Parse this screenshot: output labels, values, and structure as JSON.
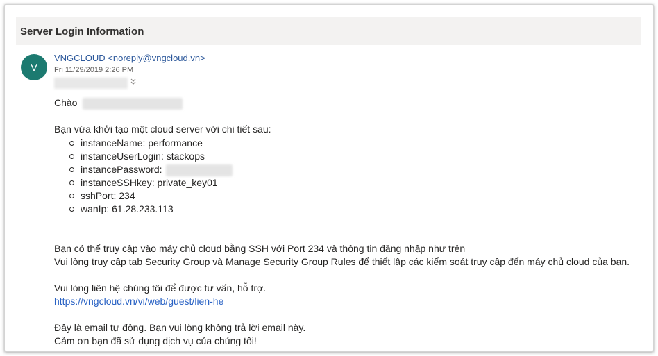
{
  "email": {
    "subject": "Server Login Information",
    "sender": {
      "avatar_initial": "V",
      "display": "VNGCLOUD <noreply@vngcloud.vn>",
      "date": "Fri 11/29/2019 2:26 PM"
    },
    "greeting": "Chào",
    "intro": "Bạn vừa khởi tạo một cloud server với chi tiết sau:",
    "details": [
      {
        "text": "instanceName: performance"
      },
      {
        "text": "instanceUserLogin: stackops"
      },
      {
        "text": "instancePassword:"
      },
      {
        "text": "instanceSSHkey: private_key01"
      },
      {
        "text": "sshPort: 234"
      },
      {
        "text": "wanIp: 61.28.233.113"
      }
    ],
    "access_line": "Bạn có thể truy cập vào máy chủ cloud bằng SSH với Port 234 và thông tin đăng nhập như trên",
    "security_line": "Vui lòng truy cập tab Security Group và Manage Security Group Rules để thiết lập các kiểm soát truy cập đến máy chủ cloud của bạn.",
    "contact_line": "Vui lòng liên hệ chúng tôi để được tư vấn, hỗ trợ.",
    "contact_link": "https://vngcloud.vn/vi/web/guest/lien-he",
    "auto_line": "Đây là email tự động. Bạn vui lòng không trả lời email này.",
    "thanks_line": "Cảm ơn bạn đã sử dụng dịch vụ của chúng tôi!"
  },
  "colors": {
    "avatar_bg": "#1c7a70",
    "sender_text": "#2b579a",
    "link": "#2962c4",
    "subject_bar_bg": "#f3f2f1"
  },
  "icons": {
    "expand": "double-chevron-down-icon"
  }
}
